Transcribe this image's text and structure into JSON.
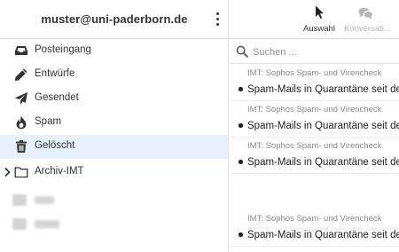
{
  "account": {
    "email": "muster@uni-paderborn.de",
    "menu_icon": "kebab-menu-icon"
  },
  "folders": [
    {
      "label": "Posteingang",
      "icon": "inbox-icon",
      "selected": false
    },
    {
      "label": "Entwürfe",
      "icon": "pencil-icon",
      "selected": false
    },
    {
      "label": "Gesendet",
      "icon": "paper-plane-icon",
      "selected": false
    },
    {
      "label": "Spam",
      "icon": "fire-icon",
      "selected": false
    },
    {
      "label": "Gelöscht",
      "icon": "trash-icon",
      "selected": true
    },
    {
      "label": "Archiv-IMT",
      "icon": "folder-icon",
      "collapsed": true
    }
  ],
  "toolbar": {
    "select_label": "Auswahl",
    "select_icon": "cursor-icon",
    "conversation_label": "Konversati...",
    "conversation_icon": "speech-bubbles-icon"
  },
  "search": {
    "placeholder": "Suchen ...",
    "value": ""
  },
  "messages": [
    {
      "sender": "IMT: Sophos Spam- und Virencheck",
      "subject": "Spam-Mails in Quarantäne seit dem",
      "unread": true
    },
    {
      "sender": "IMT: Sophos Spam- und Virencheck",
      "subject": "Spam-Mails in Quarantäne seit dem",
      "unread": true
    },
    {
      "sender": "IMT: Sophos Spam- und Virencheck",
      "subject": "Spam-Mails in Quarantäne seit dem",
      "unread": true
    },
    {
      "sender": "IMT: Sophos Spam- und Virencheck",
      "subject": "Spam-Mails in Quarantäne seit dem",
      "unread": true
    }
  ],
  "colors": {
    "selected_folder_bg": "#e6f1fb",
    "text": "#333333",
    "disabled": "#b5b5b5"
  }
}
